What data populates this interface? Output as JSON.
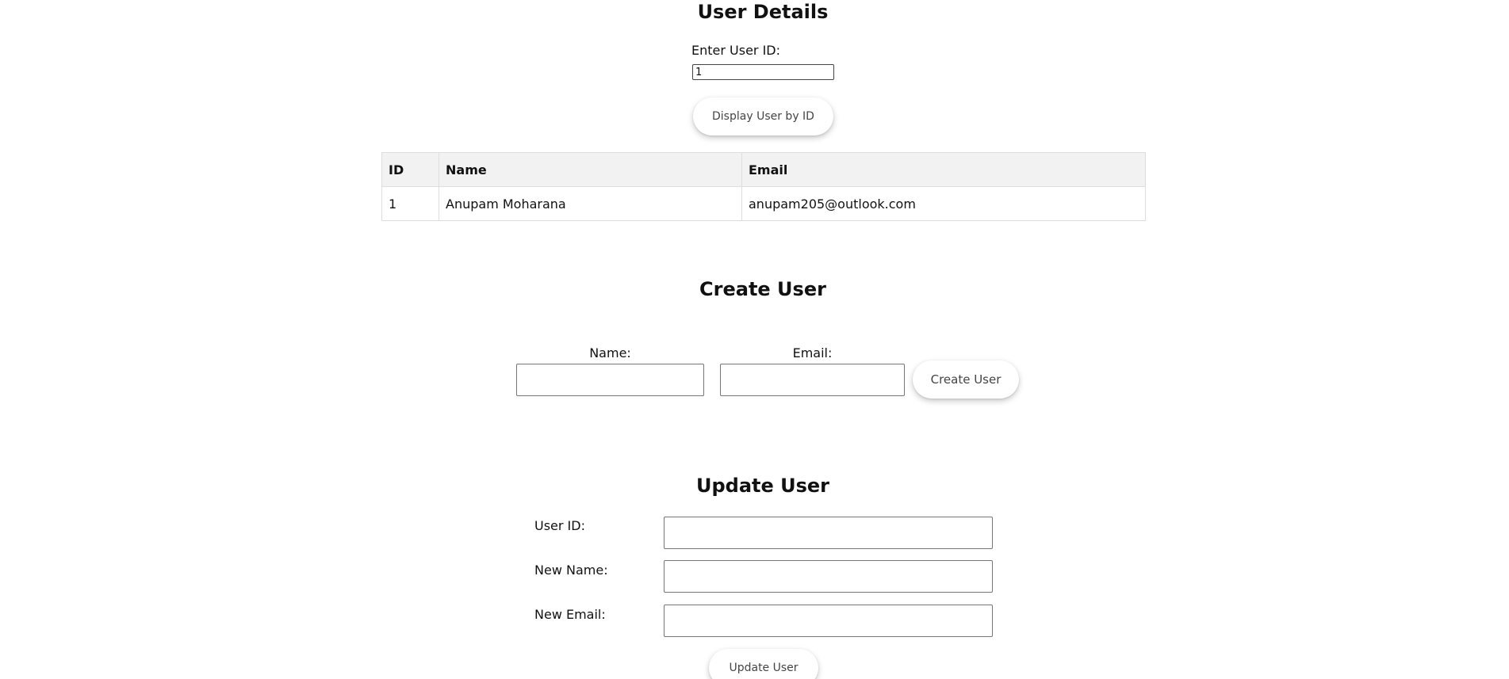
{
  "details": {
    "title": "User Details",
    "id_label": "Enter User ID:",
    "id_value": "1",
    "display_button": "Display User by ID",
    "table": {
      "headers": [
        "ID",
        "Name",
        "Email"
      ],
      "rows": [
        [
          "1",
          "Anupam Moharana",
          "anupam205@outlook.com"
        ]
      ]
    }
  },
  "create": {
    "title": "Create User",
    "name_label": "Name:",
    "email_label": "Email:",
    "name_value": "",
    "email_value": "",
    "button": "Create User"
  },
  "update": {
    "title": "Update User",
    "id_label": "User ID:",
    "name_label": "New Name:",
    "email_label": "New Email:",
    "id_value": "",
    "name_value": "",
    "email_value": "",
    "button": "Update User"
  }
}
